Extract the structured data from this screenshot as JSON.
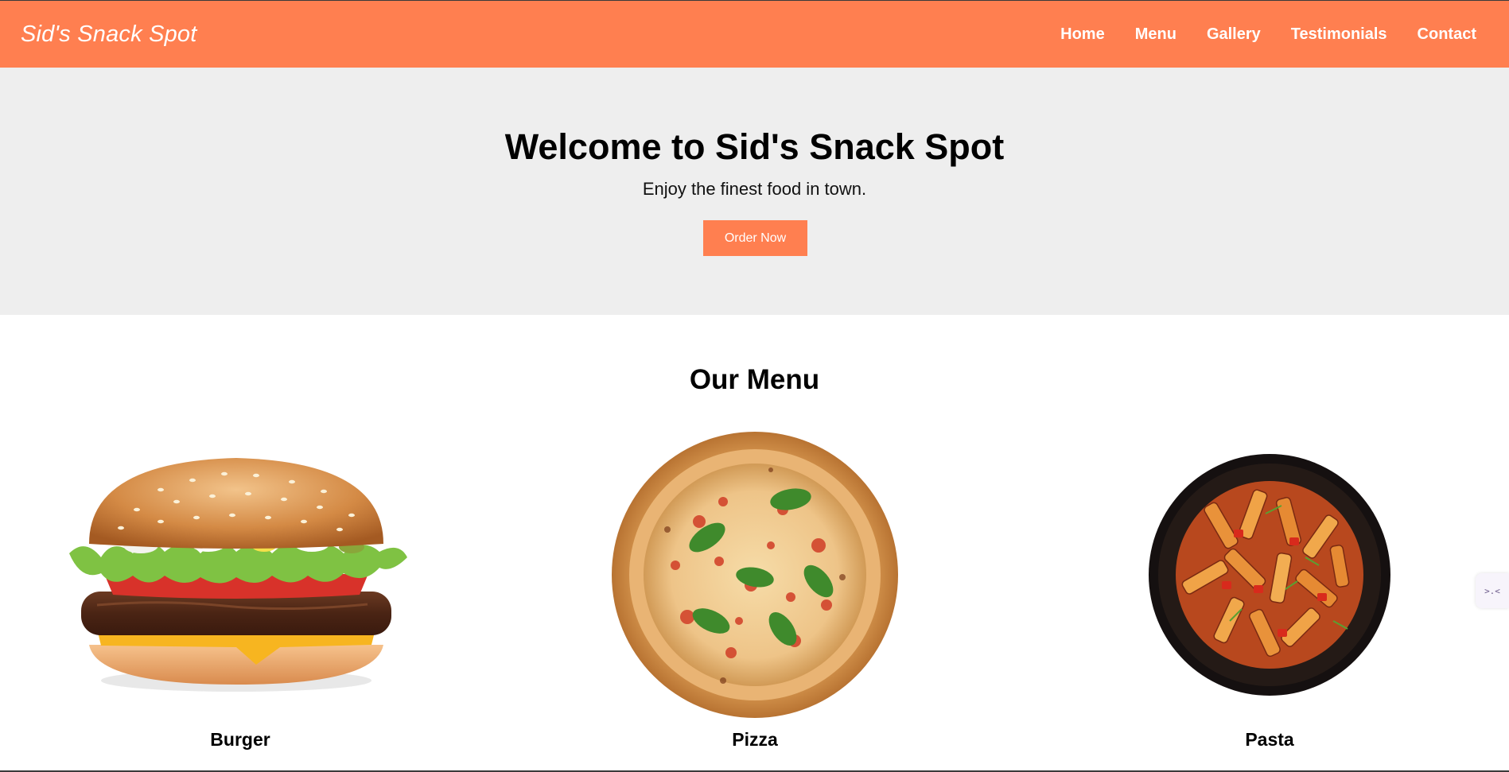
{
  "header": {
    "brand": "Sid's Snack Spot",
    "nav": [
      "Home",
      "Menu",
      "Gallery",
      "Testimonials",
      "Contact"
    ]
  },
  "hero": {
    "title": "Welcome to Sid's Snack Spot",
    "subtitle": "Enjoy the finest food in town.",
    "cta": "Order Now"
  },
  "menu": {
    "title": "Our Menu",
    "items": [
      {
        "name": "Burger",
        "image": "burger"
      },
      {
        "name": "Pizza",
        "image": "pizza"
      },
      {
        "name": "Pasta",
        "image": "pasta"
      }
    ]
  },
  "widget": {
    "icon": "chat-widget-icon",
    "glyph": ">.<"
  },
  "colors": {
    "accent": "#ff7f50",
    "hero_bg": "#eeeeee",
    "text": "#000000"
  }
}
